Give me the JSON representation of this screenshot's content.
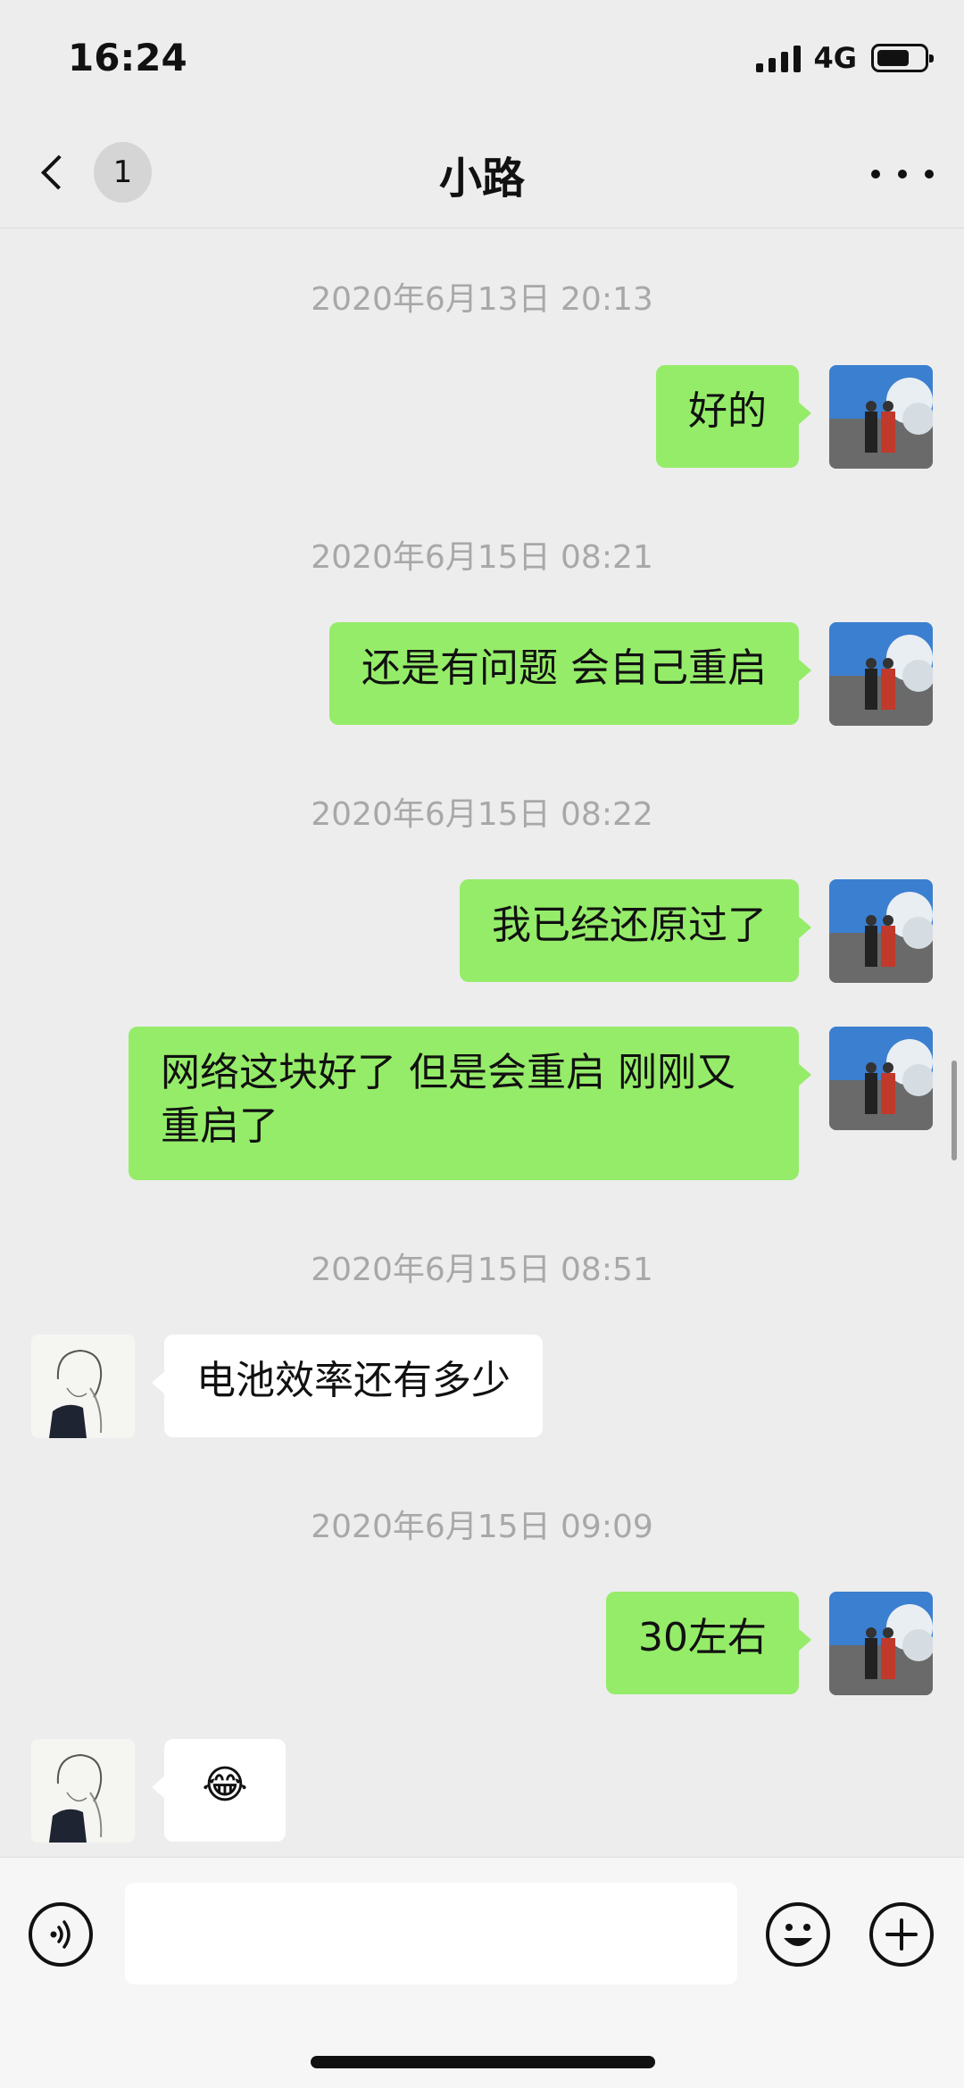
{
  "status_bar": {
    "time": "16:24",
    "network": "4G",
    "battery_level": 0.7
  },
  "nav": {
    "unread_count": "1",
    "title": "小路",
    "back_icon": "chevron-left-icon",
    "more_icon": "ellipsis-icon"
  },
  "messages": {
    "t1": "2020年6月13日 20:13",
    "m1": "好的",
    "t2": "2020年6月15日 08:21",
    "m2": "还是有问题 会自己重启",
    "t3": "2020年6月15日 08:22",
    "m3": "我已经还原过了",
    "m4": "网络这块好了 但是会重启 刚刚又重启了",
    "t4": "2020年6月15日 08:51",
    "m5": "电池效率还有多少",
    "t5": "2020年6月15日 09:09",
    "m6": "30左右",
    "m7": "😂"
  },
  "input_bar": {
    "message_value": "",
    "voice_icon": "voice-icon",
    "emoji_icon": "smiley-icon",
    "plus_icon": "plus-icon"
  },
  "colors": {
    "self_bubble": "#95ec69",
    "other_bubble": "#ffffff",
    "background": "#ededed"
  }
}
